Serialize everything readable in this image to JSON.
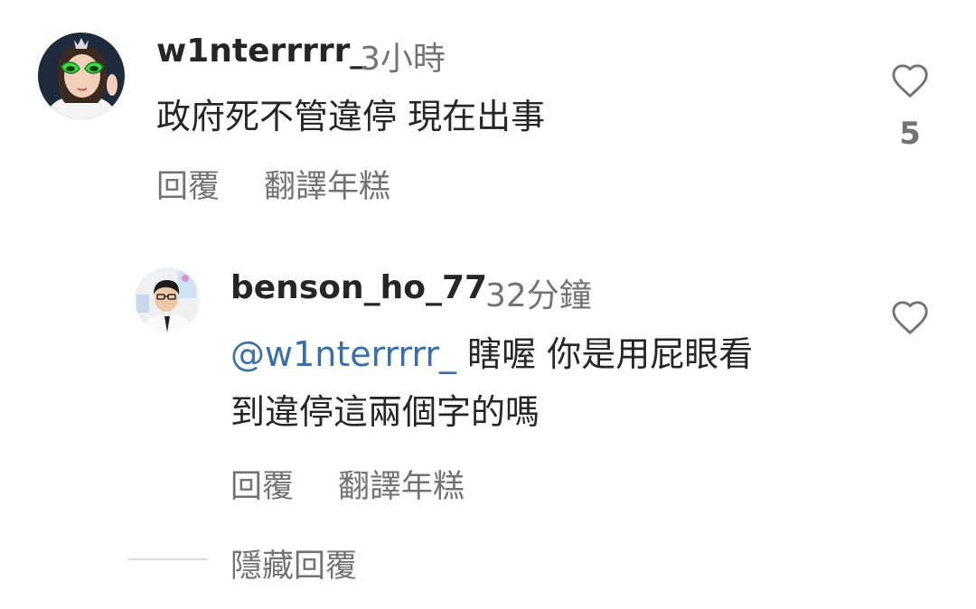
{
  "comments": [
    {
      "username": "w1nterrrrr_",
      "time": "3小時",
      "text": "政府死不管違停 現在出事",
      "reply_label": "回覆",
      "translate_label": "翻譯年糕",
      "like_icon": "heart-outline",
      "like_count": "5"
    },
    {
      "username": "benson_ho_77",
      "time": "32分鐘",
      "mention": "@w1nterrrrr_",
      "text_line1": " 瞎喔 你是用屁眼看",
      "text_line2": "到違停這兩個字的嗎",
      "reply_label": "回覆",
      "translate_label": "翻譯年糕",
      "like_icon": "heart-outline"
    }
  ],
  "hide_replies_label": "隱藏回覆"
}
